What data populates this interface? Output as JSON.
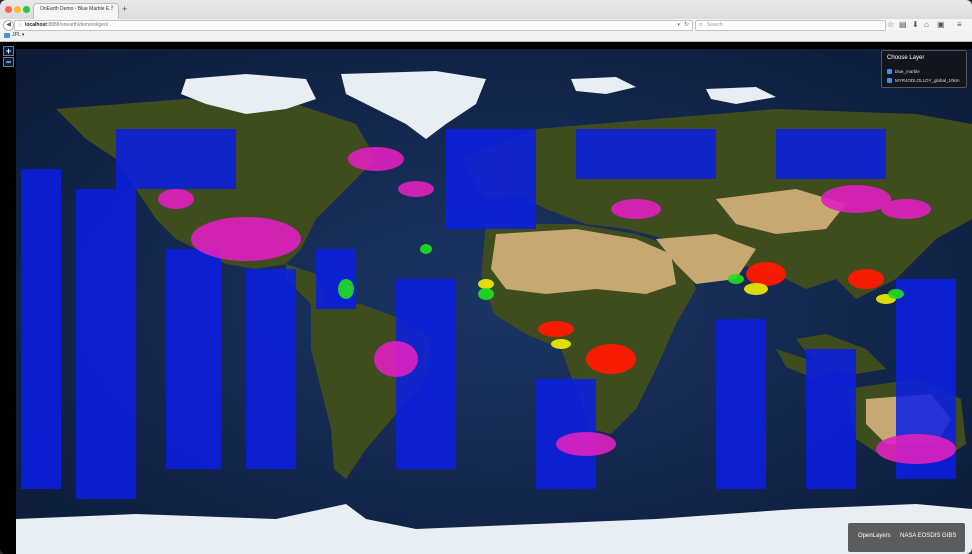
{
  "browser": {
    "tab_title": "OnEarth Demo - Blue Marble E...",
    "tab_close": "×",
    "new_tab": "+",
    "url_host": "localhost",
    "url_path": ":8888/onearth/demo/ol/geo/",
    "search_placeholder": "Search",
    "bookmark_label": "JPL"
  },
  "map": {
    "zoom_in": "+",
    "zoom_out": "−",
    "layer_panel": {
      "title": "Choose Layer",
      "layers": [
        {
          "label": "blue_marble",
          "checked": true
        },
        {
          "label": "MYR4ODLOLLDY_global_10km",
          "checked": true
        }
      ]
    },
    "attribution": [
      "OpenLayers",
      "NASA EOSDIS GIBS"
    ]
  },
  "colors": {
    "ocean": "#14254a",
    "land": "#3f4d1e",
    "desert": "#c8a872",
    "ice": "#e9eef2",
    "overlay_blue": "#0a1ee6",
    "overlay_magenta": "#e020c0",
    "overlay_red": "#ff1a00",
    "overlay_yellow": "#f0f000",
    "overlay_green": "#20e020"
  }
}
